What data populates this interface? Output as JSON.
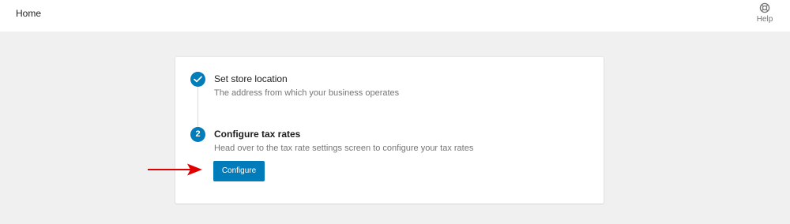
{
  "header": {
    "title": "Home",
    "help_label": "Help",
    "help_icon": "help-icon"
  },
  "task_list": {
    "steps": [
      {
        "status": "completed",
        "marker_icon": "checkmark-icon",
        "title": "Set store location",
        "description": "The address from which your business operates"
      },
      {
        "status": "current",
        "number": "2",
        "title": "Configure tax rates",
        "description": "Head over to the tax rate settings screen to configure your tax rates",
        "button_label": "Configure"
      }
    ]
  },
  "annotation": {
    "arrow_icon": "red-arrow-icon",
    "color": "#e00000"
  },
  "colors": {
    "accent": "#007cba",
    "background": "#f0f0f1",
    "card": "#ffffff",
    "text": "#1e1e1e",
    "muted_text": "#757575"
  }
}
